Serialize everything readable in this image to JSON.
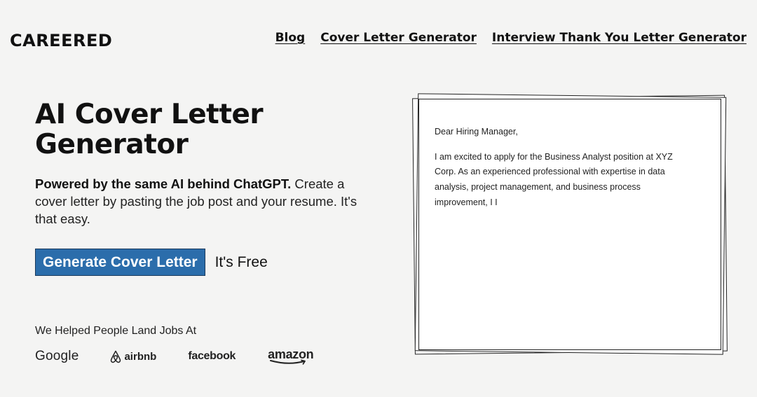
{
  "header": {
    "logo": "CAREERED",
    "nav": [
      {
        "label": "Blog"
      },
      {
        "label": "Cover Letter Generator"
      },
      {
        "label": "Interview Thank You Letter Generator"
      }
    ]
  },
  "hero": {
    "title": "AI Cover Letter Generator",
    "description_bold": "Powered by the same AI behind ChatGPT.",
    "description_rest": " Create a cover letter by pasting the job post and your resume. It's that easy.",
    "cta_label": "Generate Cover Letter",
    "free_label": "It's Free"
  },
  "social_proof": {
    "heading": "We Helped People Land Jobs At",
    "companies": [
      {
        "name": "Google",
        "icon": "google-logo"
      },
      {
        "name": "airbnb",
        "icon": "airbnb-logo"
      },
      {
        "name": "facebook",
        "icon": "facebook-logo"
      },
      {
        "name": "amazon",
        "icon": "amazon-logo"
      }
    ]
  },
  "letter_preview": {
    "greeting": "Dear Hiring Manager,",
    "body": "I am excited to apply for the Business Analyst position at XYZ Corp. As an experienced professional with expertise in data analysis, project management, and business process improvement, I I"
  },
  "colors": {
    "background": "#f4f4f3",
    "cta_background": "#2b6dab",
    "cta_border": "#1a3a5c",
    "text": "#111111"
  }
}
